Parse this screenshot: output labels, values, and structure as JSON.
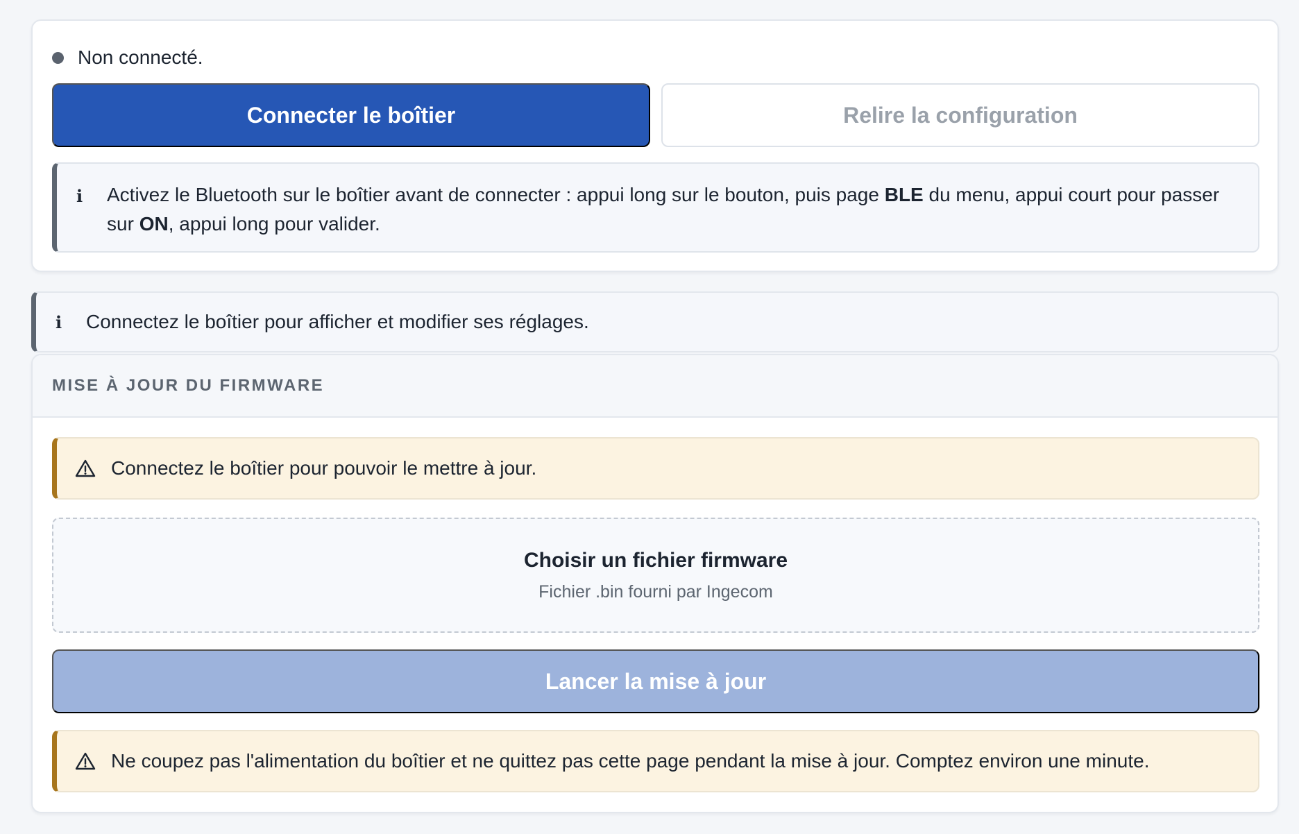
{
  "connection": {
    "status_text": "Non connecté.",
    "connect_button_label": "Connecter le boîtier",
    "reread_button_label": "Relire la configuration",
    "info": {
      "part1": "Activez le Bluetooth sur le boîtier avant de connecter : appui long sur le bouton, puis page ",
      "bold1": "BLE",
      "part2": " du menu, appui court pour passer sur ",
      "bold2": "ON",
      "part3": ", appui long pour valider."
    }
  },
  "settings_notice": {
    "text": "Connectez le boîtier pour afficher et modifier ses réglages."
  },
  "firmware": {
    "title": "Mise à jour du firmware",
    "connect_warning": "Connectez le boîtier pour pouvoir le mettre à jour.",
    "file_picker_title": "Choisir un fichier firmware",
    "file_picker_subtitle": "Fichier .bin fourni par Ingecom",
    "launch_button_label": "Lancer la mise à jour",
    "power_warning": "Ne coupez pas l'alimentation du boîtier et ne quittez pas cette page pendant la mise à jour. Comptez environ une minute."
  },
  "icons": {
    "info": "info-icon",
    "warning": "warning-icon",
    "status": "status-dot-icon"
  },
  "colors": {
    "primary": "#2657b5",
    "primary_disabled": "#9db3dc",
    "status_dot": "#5a626e",
    "info_accent": "#5c6570",
    "warning_accent": "#a7751c",
    "warning_background": "#fcf3e1"
  }
}
